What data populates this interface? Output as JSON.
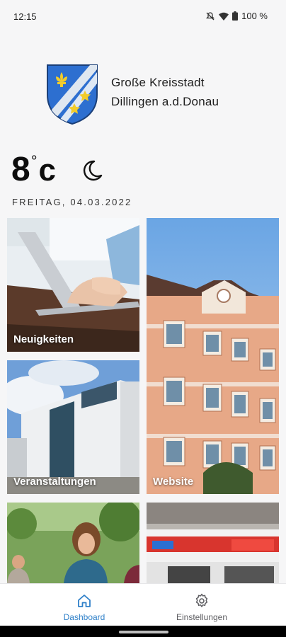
{
  "status_bar": {
    "time": "12:15",
    "battery": "100 %",
    "icons": [
      "mute-icon",
      "wifi-icon",
      "battery-icon"
    ]
  },
  "brand": {
    "line1": "Große Kreisstadt",
    "line2": "Dillingen a.d.Donau",
    "crest": "dillingen-coat-of-arms"
  },
  "weather": {
    "temperature": "8",
    "degree": "°",
    "unit": "c",
    "condition_icon": "moon-icon",
    "date": "FREITAG, 04.03.2022"
  },
  "tiles": [
    {
      "label": "Neuigkeiten"
    },
    {
      "label": "Website"
    },
    {
      "label": "Veranstaltungen"
    },
    {
      "label": ""
    },
    {
      "label": ""
    }
  ],
  "bottom_nav": {
    "items": [
      {
        "label": "Dashboard",
        "icon": "home-icon",
        "active": true
      },
      {
        "label": "Einstellungen",
        "icon": "gear-icon",
        "active": false
      }
    ]
  },
  "colors": {
    "accent": "#2f80c9",
    "nav_inactive": "#5e5e62",
    "background": "#f6f6f7"
  }
}
